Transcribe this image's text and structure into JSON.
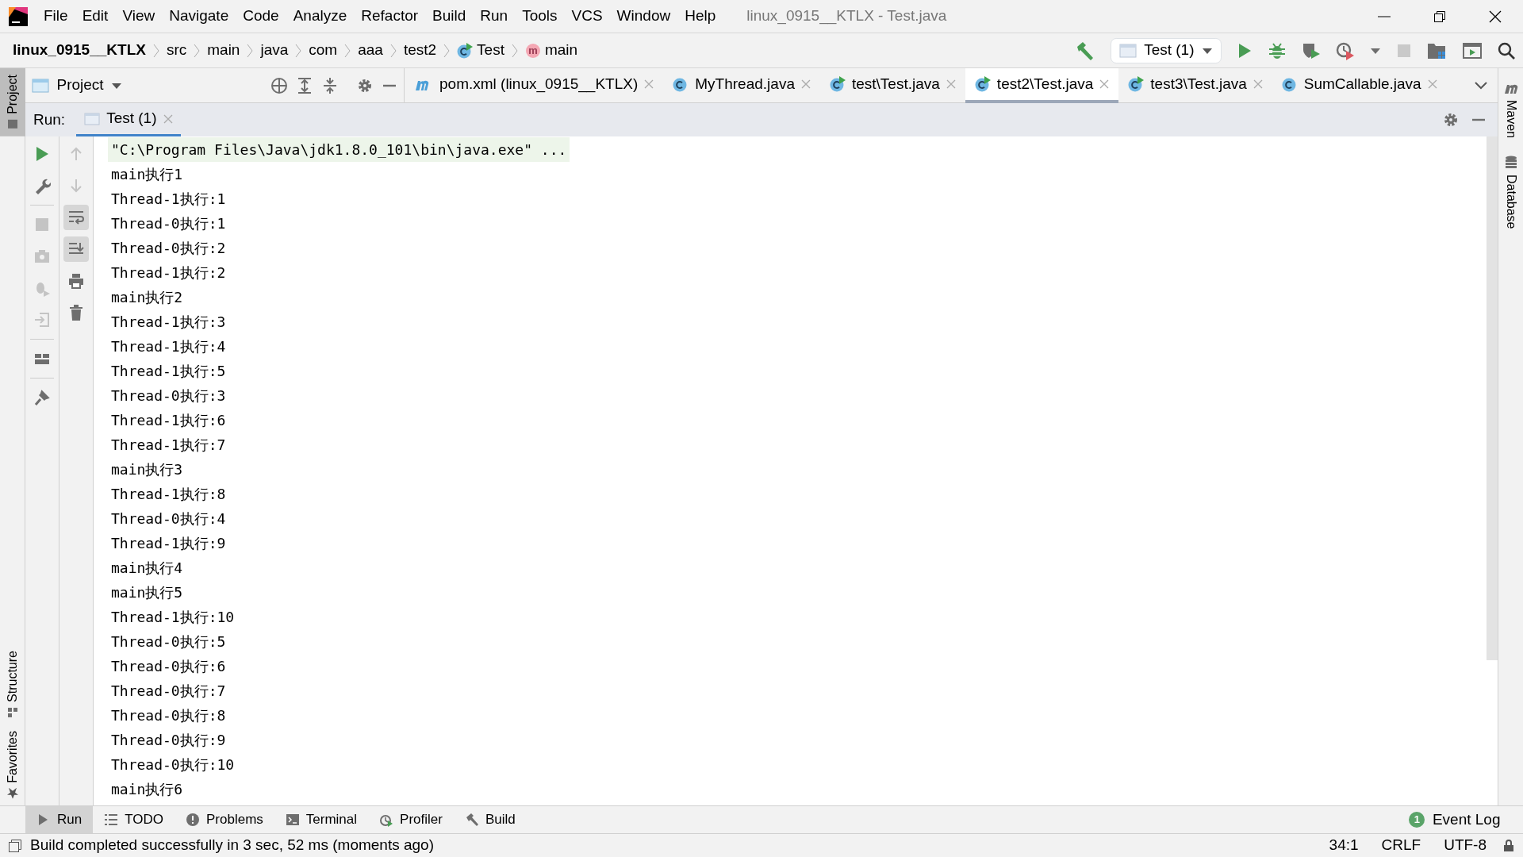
{
  "window": {
    "title": "linux_0915__KTLX - Test.java"
  },
  "menu": [
    "File",
    "Edit",
    "View",
    "Navigate",
    "Code",
    "Analyze",
    "Refactor",
    "Build",
    "Run",
    "Tools",
    "VCS",
    "Window",
    "Help"
  ],
  "breadcrumbs": [
    {
      "label": "linux_0915__KTLX",
      "kind": "project"
    },
    {
      "label": "src",
      "kind": "folder"
    },
    {
      "label": "main",
      "kind": "folder"
    },
    {
      "label": "java",
      "kind": "folder"
    },
    {
      "label": "com",
      "kind": "folder"
    },
    {
      "label": "aaa",
      "kind": "folder"
    },
    {
      "label": "test2",
      "kind": "folder"
    },
    {
      "label": "Test",
      "kind": "class-run"
    },
    {
      "label": "main",
      "kind": "method"
    }
  ],
  "run_config": "Test (1)",
  "project_panel": {
    "title": "Project"
  },
  "editor_tabs": [
    {
      "label": "pom.xml (linux_0915__KTLX)",
      "kind": "maven",
      "selected": false
    },
    {
      "label": "MyThread.java",
      "kind": "class",
      "selected": false
    },
    {
      "label": "test\\Test.java",
      "kind": "class-run",
      "selected": false
    },
    {
      "label": "test2\\Test.java",
      "kind": "class-run",
      "selected": true
    },
    {
      "label": "test3\\Test.java",
      "kind": "class-run",
      "selected": false
    },
    {
      "label": "SumCallable.java",
      "kind": "class",
      "selected": false
    }
  ],
  "run_panel": {
    "label": "Run:",
    "tab": "Test (1)"
  },
  "console": [
    {
      "text": "\"C:\\Program Files\\Java\\jdk1.8.0_101\\bin\\java.exe\" ...",
      "kind": "command"
    },
    {
      "text": "main执行1",
      "kind": "output"
    },
    {
      "text": "Thread-1执行:1",
      "kind": "output"
    },
    {
      "text": "Thread-0执行:1",
      "kind": "output"
    },
    {
      "text": "Thread-0执行:2",
      "kind": "output"
    },
    {
      "text": "Thread-1执行:2",
      "kind": "output"
    },
    {
      "text": "main执行2",
      "kind": "output"
    },
    {
      "text": "Thread-1执行:3",
      "kind": "output"
    },
    {
      "text": "Thread-1执行:4",
      "kind": "output"
    },
    {
      "text": "Thread-1执行:5",
      "kind": "output"
    },
    {
      "text": "Thread-0执行:3",
      "kind": "output"
    },
    {
      "text": "Thread-1执行:6",
      "kind": "output"
    },
    {
      "text": "Thread-1执行:7",
      "kind": "output"
    },
    {
      "text": "main执行3",
      "kind": "output"
    },
    {
      "text": "Thread-1执行:8",
      "kind": "output"
    },
    {
      "text": "Thread-0执行:4",
      "kind": "output"
    },
    {
      "text": "Thread-1执行:9",
      "kind": "output"
    },
    {
      "text": "main执行4",
      "kind": "output"
    },
    {
      "text": "main执行5",
      "kind": "output"
    },
    {
      "text": "Thread-1执行:10",
      "kind": "output"
    },
    {
      "text": "Thread-0执行:5",
      "kind": "output"
    },
    {
      "text": "Thread-0执行:6",
      "kind": "output"
    },
    {
      "text": "Thread-0执行:7",
      "kind": "output"
    },
    {
      "text": "Thread-0执行:8",
      "kind": "output"
    },
    {
      "text": "Thread-0执行:9",
      "kind": "output"
    },
    {
      "text": "Thread-0执行:10",
      "kind": "output"
    },
    {
      "text": "main执行6",
      "kind": "output"
    }
  ],
  "left_stripe": {
    "top": [
      "Project"
    ],
    "bottom": [
      "Structure",
      "Favorites"
    ]
  },
  "right_stripe": [
    "Maven",
    "Database"
  ],
  "bottom_tabs": [
    {
      "label": "Run",
      "kind": "run",
      "selected": true
    },
    {
      "label": "TODO",
      "kind": "todo",
      "selected": false
    },
    {
      "label": "Problems",
      "kind": "problems",
      "selected": false
    },
    {
      "label": "Terminal",
      "kind": "terminal",
      "selected": false
    },
    {
      "label": "Profiler",
      "kind": "profiler",
      "selected": false
    },
    {
      "label": "Build",
      "kind": "build",
      "selected": false
    }
  ],
  "event_log": {
    "count": "1",
    "label": "Event Log"
  },
  "status_bar": {
    "message": "Build completed successfully in 3 sec, 52 ms (moments ago)",
    "position": "34:1",
    "line_separator": "CRLF",
    "encoding": "UTF-8"
  }
}
